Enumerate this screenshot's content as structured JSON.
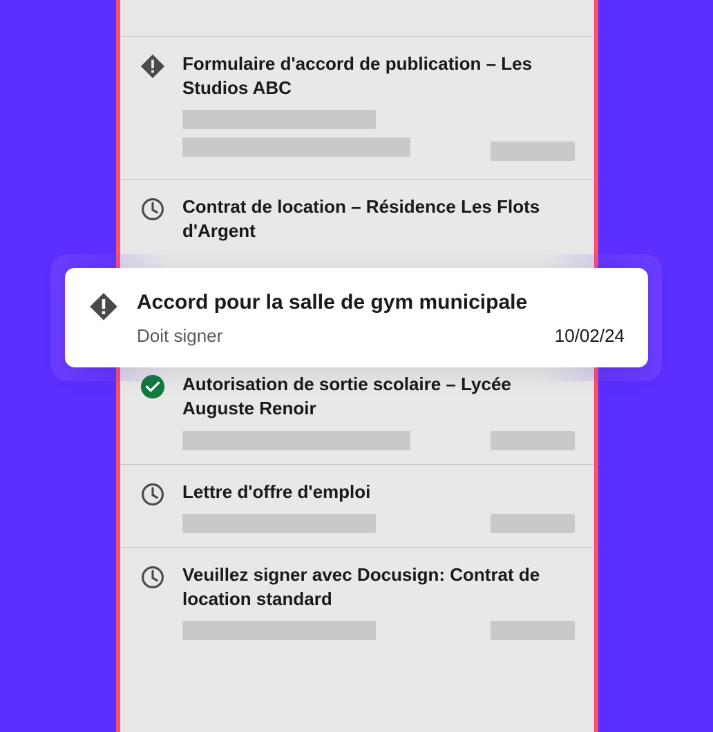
{
  "items": [
    {
      "title": "Formulaire d'accord de publication – Les Studios ABC",
      "icon": "alert",
      "skeleton": "double"
    },
    {
      "title": "Contrat de location – Résidence Les Flots d'Argent",
      "icon": "clock",
      "skeleton": "none"
    },
    {
      "title": "Autorisation de sortie scolaire – Lycée Auguste Renoir",
      "icon": "check",
      "skeleton": "single"
    },
    {
      "title": "Lettre d'offre d'emploi",
      "icon": "clock",
      "skeleton": "single"
    },
    {
      "title": "Veuillez signer avec Docusign: Contrat de location standard",
      "icon": "clock",
      "skeleton": "single"
    }
  ],
  "highlight": {
    "title": "Accord pour la salle de gym municipale",
    "status": "Doit signer",
    "date": "10/02/24"
  }
}
